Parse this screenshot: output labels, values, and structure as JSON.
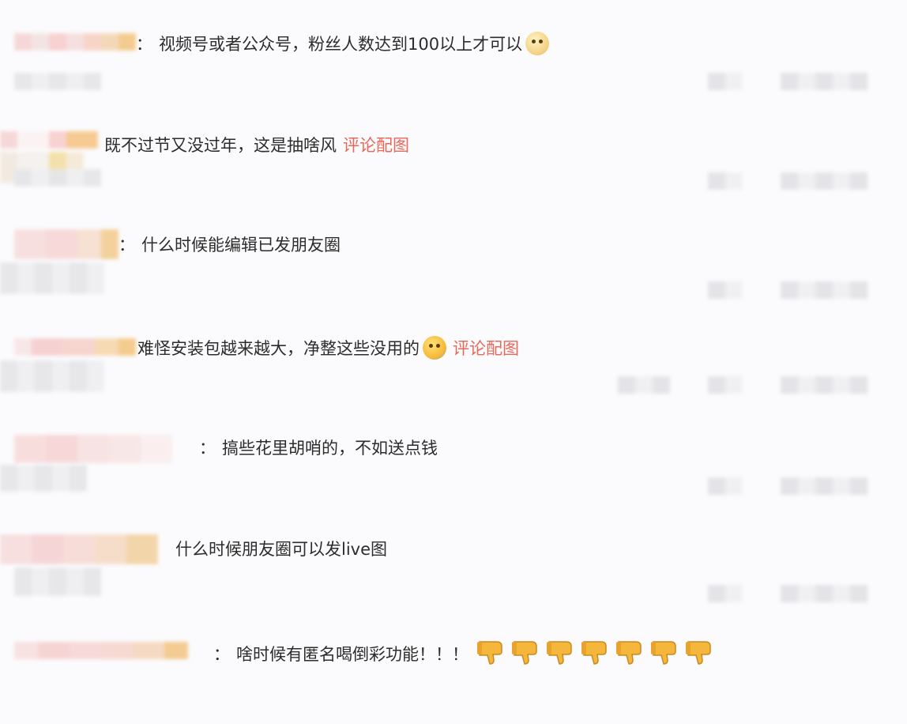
{
  "comments": [
    {
      "text": "视频号或者公众号，粉丝人数达到100以上才可以",
      "colon": "：",
      "emoji": "doge-emoji",
      "link": ""
    },
    {
      "text": "既不过节又没过年，这是抽啥风",
      "colon": "",
      "emoji": "",
      "link": "评论配图"
    },
    {
      "text": "什么时候能编辑已发朋友圈",
      "colon": "：",
      "emoji": "",
      "link": ""
    },
    {
      "text": "难怪安装包越来越大，净整这些没用的",
      "colon": "",
      "emoji": "crying-laugh-emoji",
      "link": "评论配图"
    },
    {
      "text": "搞些花里胡哨的，不如送点钱",
      "colon": "：",
      "emoji": "",
      "link": ""
    },
    {
      "text": "什么时候朋友圈可以发live图",
      "colon": "",
      "emoji": "",
      "link": ""
    },
    {
      "text": "啥时候有匿名喝倒彩功能！！！",
      "colon": "：",
      "emoji": "thumbs-down-icon",
      "link": ""
    }
  ],
  "colors": {
    "link": "#e8685a",
    "text": "#2c2c2c",
    "background": "#fbfbfd",
    "thumbs_down": "#f4b73c"
  }
}
